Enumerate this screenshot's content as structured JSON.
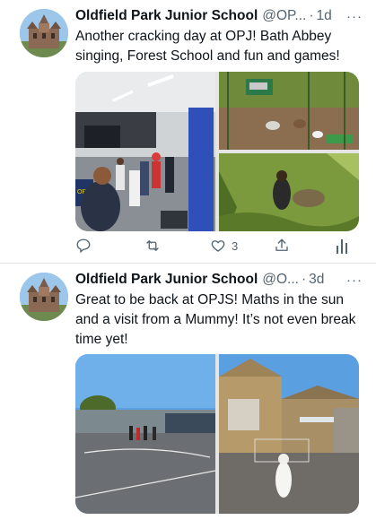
{
  "tweets": [
    {
      "author_name": "Oldfield Park Junior School",
      "handle": "@OP...",
      "time": "1d",
      "text": "Another cracking day at OPJ! Bath Abbey singing, Forest School and fun and games!",
      "likes": "3",
      "media_count": 3,
      "icons": [
        "reply-icon",
        "retweet-icon",
        "like-icon",
        "share-icon",
        "analytics-icon"
      ]
    },
    {
      "author_name": "Oldfield Park Junior School",
      "handle": "@O...",
      "time": "3d",
      "text": "Great to be back at OPJS! Maths in the sun and a visit from a Mummy! It’s not even break time yet!",
      "media_count": 2
    }
  ],
  "separator": "·",
  "more_glyph": "···",
  "media_labels": {
    "ops_sign": "OPJS"
  },
  "colors": {
    "secondary_text": "#536471",
    "divider": "#dfe3e6",
    "sky": "#5a9fe0"
  }
}
